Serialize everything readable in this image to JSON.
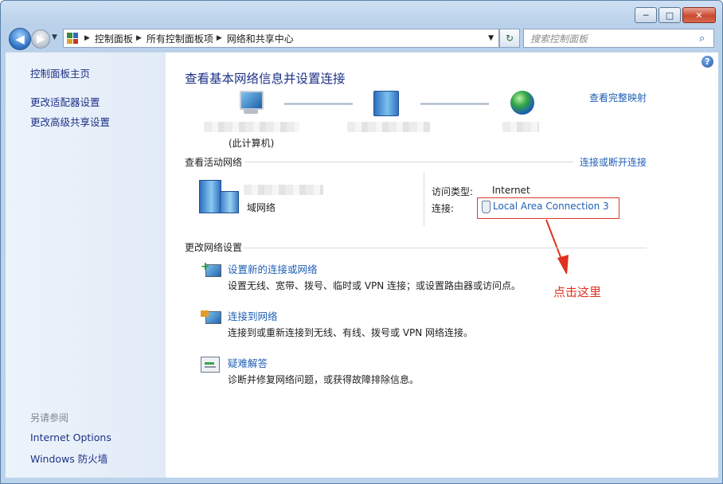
{
  "window": {
    "minimize": "─",
    "maximize": "□",
    "close": "✕"
  },
  "address": {
    "crumbs": [
      "控制面板",
      "所有控制面板项",
      "网络和共享中心"
    ],
    "search_placeholder": "搜索控制面板"
  },
  "sidebar": {
    "home": "控制面板主页",
    "items": [
      "更改适配器设置",
      "更改高级共享设置"
    ],
    "see_also_heading": "另请参阅",
    "see_also": [
      "Internet Options",
      "Windows 防火墙"
    ]
  },
  "main": {
    "title": "查看基本网络信息并设置连接",
    "view_full_map": "查看完整映射",
    "this_computer": "(此计算机)",
    "active_networks_label": "查看活动网络",
    "connect_disconnect": "连接或断开连接",
    "network_type": "域网络",
    "access_type_label": "访问类型:",
    "access_type_value": "Internet",
    "connections_label": "连接:",
    "connection_name": "Local Area Connection 3",
    "change_settings_label": "更改网络设置",
    "tasks": [
      {
        "title": "设置新的连接或网络",
        "desc": "设置无线、宽带、拨号、临时或 VPN 连接；或设置路由器或访问点。",
        "icon": "new-connection-icon"
      },
      {
        "title": "连接到网络",
        "desc": "连接到或重新连接到无线、有线、拨号或 VPN 网络连接。",
        "icon": "connect-network-icon"
      },
      {
        "title": "疑难解答",
        "desc": "诊断并修复网络问题，或获得故障排除信息。",
        "icon": "troubleshoot-icon"
      }
    ],
    "annotation": "点击这里",
    "annotation_color": "#e0311e"
  }
}
